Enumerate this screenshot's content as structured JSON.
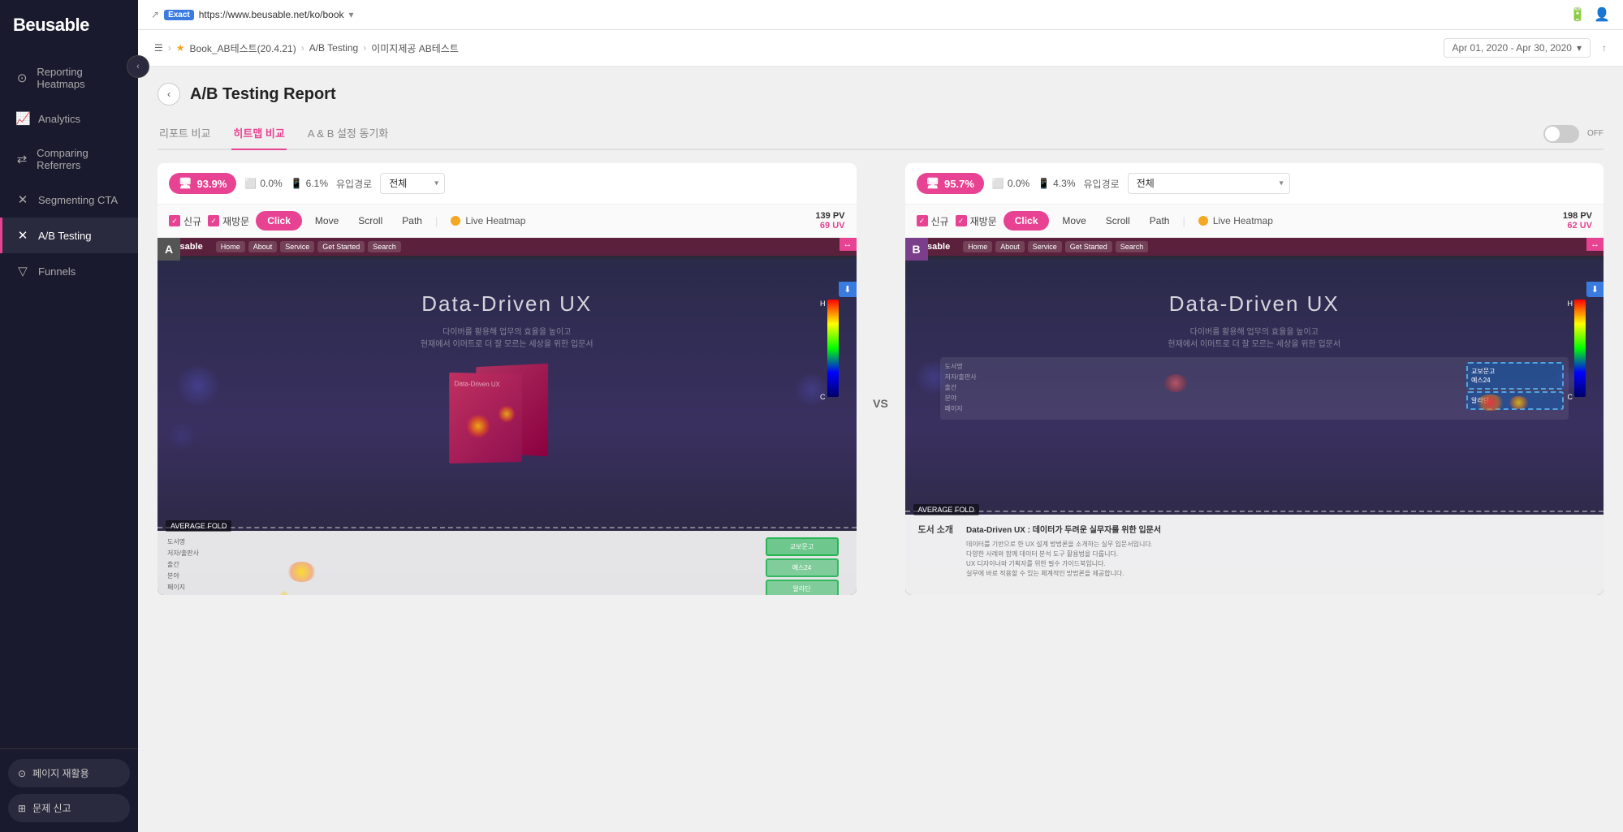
{
  "app": {
    "name": "Beusable"
  },
  "topbar": {
    "exact_badge": "Exact",
    "url": "https://www.beusable.net/ko/book",
    "dropdown_icon": "▾"
  },
  "breadcrumb": {
    "items": [
      "Book_AB테스트(20.4.21)",
      "A/B Testing",
      "이미지제공 AB테스트"
    ],
    "date_range": "Apr 01, 2020 - Apr 30, 2020"
  },
  "sidebar": {
    "logo": "Beusable",
    "items": [
      {
        "id": "reporting-heatmaps",
        "label": "Reporting Heatmaps",
        "icon": "⊙"
      },
      {
        "id": "analytics",
        "label": "Analytics",
        "icon": "📊"
      },
      {
        "id": "comparing-referrers",
        "label": "Comparing Referrers",
        "icon": "⇄"
      },
      {
        "id": "segmenting-cta",
        "label": "Segmenting CTA",
        "icon": "✕"
      },
      {
        "id": "ab-testing",
        "label": "A/B Testing",
        "icon": "✕",
        "active": true
      },
      {
        "id": "funnels",
        "label": "Funnels",
        "icon": "▽"
      }
    ],
    "bottom_buttons": [
      {
        "id": "page-replay",
        "label": "페이지 재활용",
        "icon": "⊙"
      },
      {
        "id": "report-issue",
        "label": "문제 신고",
        "icon": "⊞"
      }
    ]
  },
  "page": {
    "title": "A/B Testing Report",
    "tabs": [
      {
        "id": "report-compare",
        "label": "리포트 비교"
      },
      {
        "id": "heatmap-compare",
        "label": "히트맵 비교",
        "active": true
      },
      {
        "id": "ab-sync",
        "label": "A & B 설정 동기화"
      }
    ],
    "sync_toggle": {
      "label": "OFF"
    }
  },
  "panel_a": {
    "label": "A",
    "metric": "93.9%",
    "metric_icon": "🖥",
    "desktop_pct": "0.0%",
    "mobile_pct": "6.1%",
    "entry_label": "유입경로",
    "entry_value": "전체",
    "checkboxes": [
      "신규",
      "재방문"
    ],
    "click_btn": "Click",
    "ctrl_btns": [
      "Move",
      "Scroll",
      "Path"
    ],
    "live_heatmap": "Live Heatmap",
    "pv": "139 PV",
    "uv": "69 UV",
    "heatmap_title": "Data-Driven UX",
    "heatmap_subtitle": "다이버를 활용해 업무의 효율을 높이고\n현재에서 이머트로 더 잘 모르는 세상을 위한 입문서",
    "average_fold": "AVERAGE FOLD"
  },
  "panel_b": {
    "label": "B",
    "metric": "95.7%",
    "metric_icon": "🖥",
    "desktop_pct": "0.0%",
    "mobile_pct": "4.3%",
    "entry_label": "유입경로",
    "entry_value": "전체",
    "checkboxes": [
      "신규",
      "재방문"
    ],
    "click_btn": "Click",
    "ctrl_btns": [
      "Move",
      "Scroll",
      "Path"
    ],
    "live_heatmap": "Live Heatmap",
    "pv": "198 PV",
    "uv": "62 UV",
    "heatmap_title": "Data-Driven UX",
    "average_fold": "AVERAGE FOLD",
    "book_section": "도서 소개",
    "book_title": "Data-Driven UX : 데이터가 두려운 실무자를 위한 입문서"
  },
  "vs_label": "VS"
}
